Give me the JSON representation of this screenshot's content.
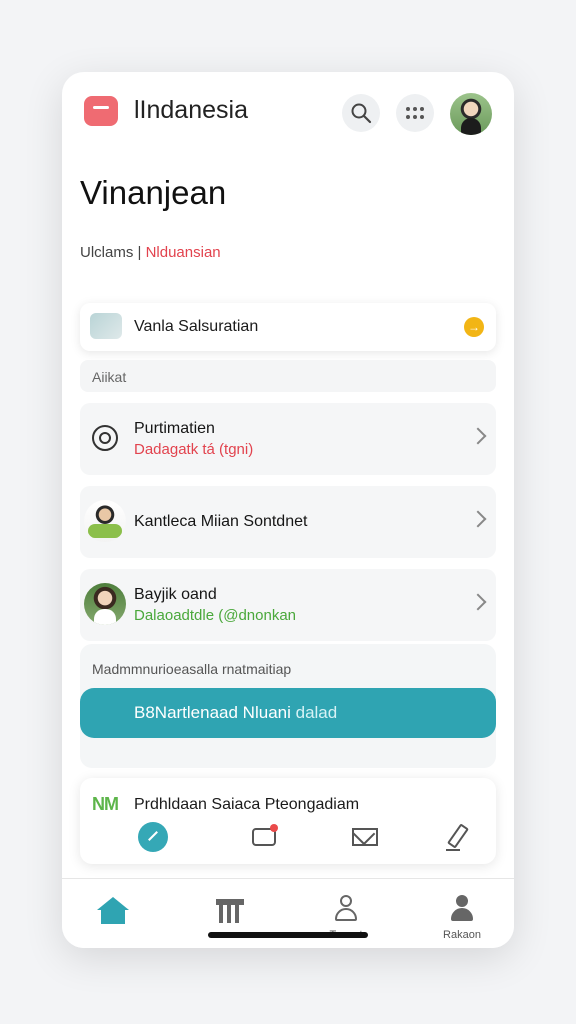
{
  "header": {
    "app_title": "lIndanesia",
    "icons": [
      "search-icon",
      "more-dots-icon",
      "profile-avatar"
    ]
  },
  "page": {
    "title": "Vinanjean",
    "subtitle_prefix": "Ulclams | ",
    "subtitle_accent": "Nlduansian"
  },
  "banner": {
    "text": "Vanla Salsuratian",
    "arrow_glyph": "→"
  },
  "section": {
    "label": "Aiikat"
  },
  "rows": [
    {
      "title": "Purtimatien",
      "subtitle": "Dadagatk tá (tgni)"
    },
    {
      "title": "Kantleca Miian Sontdnet",
      "subtitle": ""
    },
    {
      "title": "Bayjik oand",
      "subtitle": "Dalaoadtdle (@dnonkan"
    }
  ],
  "cta": {
    "caption": "Madmmnurioeasalla rnatmaitiap",
    "button_main": "B8Nartlenaad Nluani ",
    "button_muted": "dalad"
  },
  "card": {
    "logo": "NM",
    "title": "Prdhldaan Saiaca Pteongadiam"
  },
  "bottom_nav": {
    "items": [
      {
        "label": "",
        "icon": "home-icon"
      },
      {
        "label": "",
        "icon": "bank-icon"
      },
      {
        "label": "Tanaat",
        "icon": "person-icon"
      },
      {
        "label": "Rakaon",
        "icon": "person-filled-icon"
      }
    ]
  },
  "colors": {
    "accent_teal": "#2fa4b2",
    "accent_red": "#e2434e",
    "accent_green": "#4aa83b",
    "logo_red": "#ef6b72",
    "arrow_yellow": "#f2b515"
  }
}
